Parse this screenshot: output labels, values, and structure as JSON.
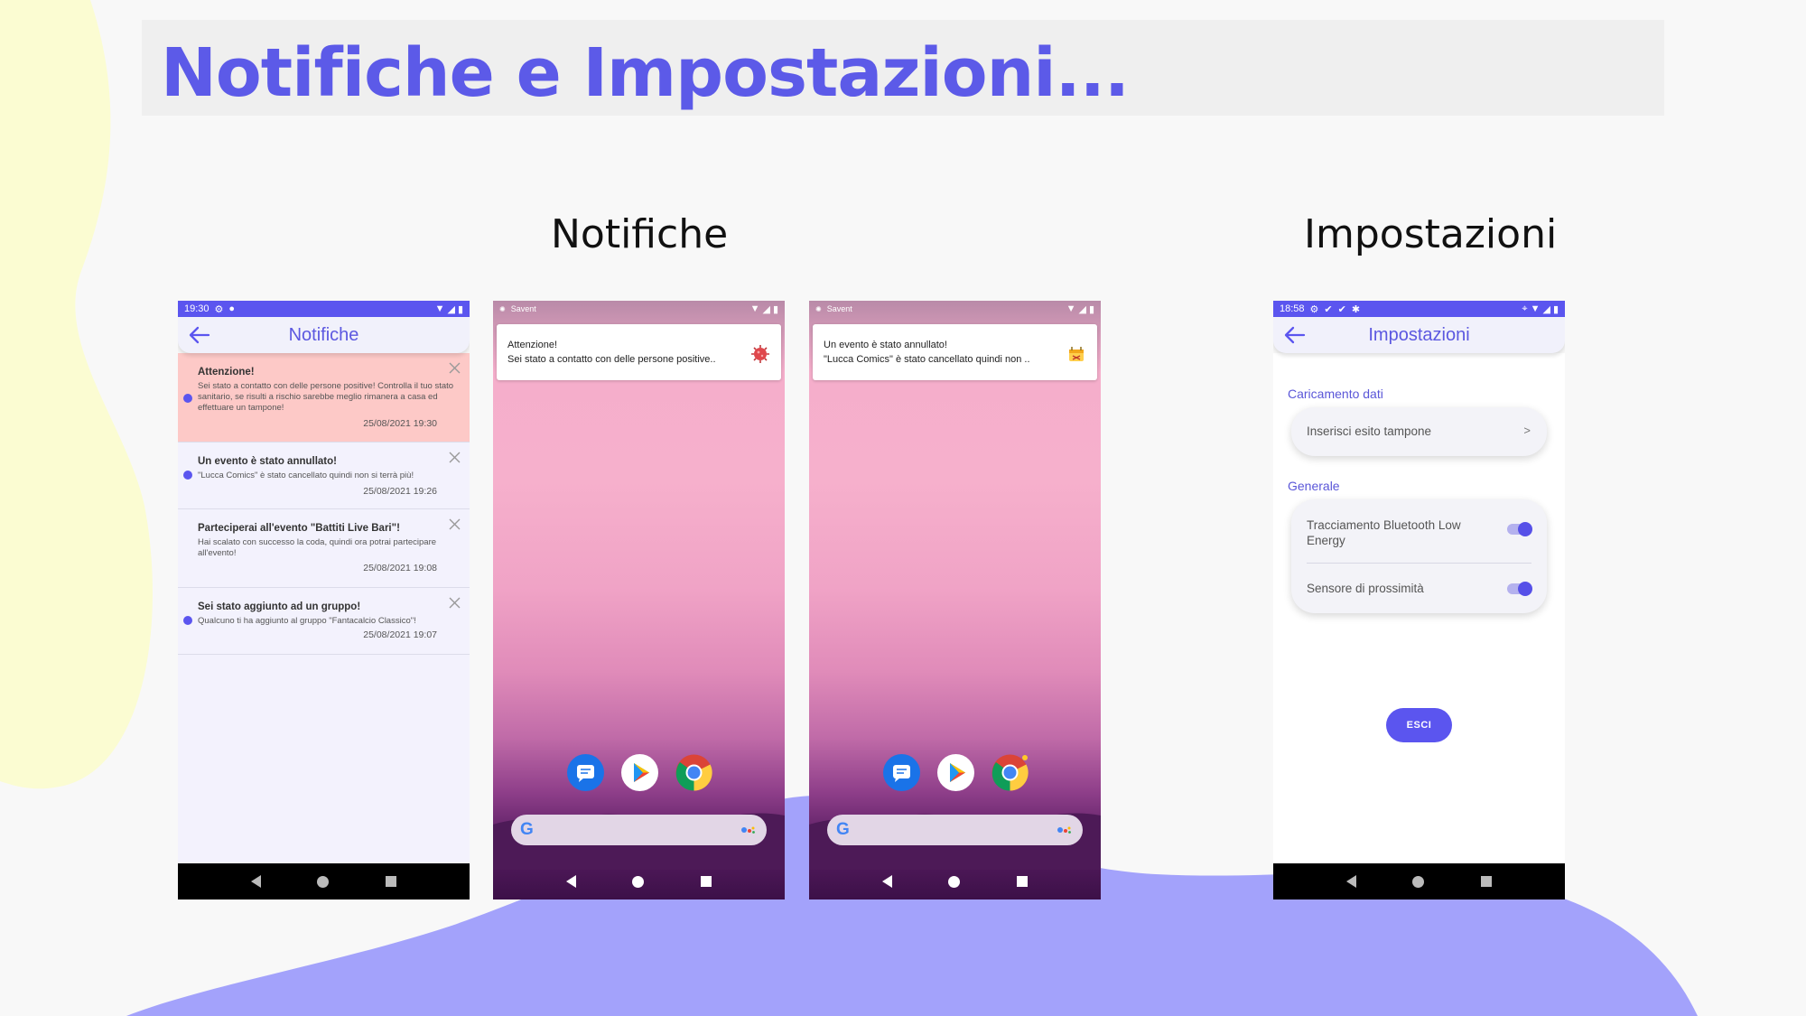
{
  "page": {
    "title": "Notifiche e Impostazioni...",
    "section_notifiche": "Notifiche",
    "section_impostazioni": "Impostazioni"
  },
  "colors": {
    "accent": "#5b55ef",
    "title": "#5c5ae8",
    "warning_card": "#fdc9c7",
    "blob_yellow": "#fbfcd2",
    "blob_purple": "#a3a2fb"
  },
  "phone_notifications": {
    "status_time": "19:30",
    "app_title": "Notifiche",
    "items": [
      {
        "title": "Attenzione!",
        "body": "Sei stato a contatto con delle persone positive! Controlla il tuo stato sanitario, se risulti a rischio sarebbe meglio rimanera a casa ed effettuare un tampone!",
        "time": "25/08/2021 19:30",
        "unread": true
      },
      {
        "title": "Un evento è stato annullato!",
        "body": "\"Lucca Comics\" è stato cancellato quindi non si terrà più!",
        "time": "25/08/2021 19:26",
        "unread": true
      },
      {
        "title": "Parteciperai all'evento \"Battiti Live Bari\"!",
        "body": "Hai scalato con successo la coda, quindi ora potrai partecipare all'evento!",
        "time": "25/08/2021 19:08",
        "unread": false
      },
      {
        "title": "Sei stato aggiunto ad un gruppo!",
        "body": "Qualcuno ti ha aggiunto al gruppo \"Fantacalcio Classico\"!",
        "time": "25/08/2021 19:07",
        "unread": true
      }
    ]
  },
  "phone_home_1": {
    "status_app": "Savent",
    "heads_up_title": "Attenzione!",
    "heads_up_body": "Sei stato a contatto con delle persone positive..",
    "heads_up_icon": "virus-icon"
  },
  "phone_home_2": {
    "status_app": "Savent",
    "heads_up_title": "Un evento è stato annullato!",
    "heads_up_body": "\"Lucca Comics\" è stato cancellato quindi non ..",
    "heads_up_icon": "event-cancelled-icon"
  },
  "home_screen": {
    "dock_apps": [
      "messages-icon",
      "play-store-icon",
      "chrome-icon"
    ],
    "search_logo": "G"
  },
  "phone_settings": {
    "status_time": "18:58",
    "app_title": "Impostazioni",
    "section_data": "Caricamento dati",
    "row_tampone": "Inserisci esito tampone",
    "row_tampone_chevron": ">",
    "section_general": "Generale",
    "toggle_ble": "Tracciamento Bluetooth Low Energy",
    "toggle_ble_on": true,
    "toggle_proximity": "Sensore di prossimità",
    "toggle_proximity_on": true,
    "logout_label": "ESCI"
  }
}
